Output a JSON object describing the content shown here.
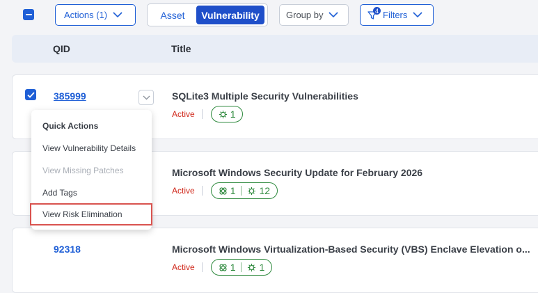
{
  "toolbar": {
    "actions_label": "Actions (1)",
    "view_toggle": {
      "asset": "Asset",
      "vulnerability": "Vulnerability"
    },
    "group_by_label": "Group by",
    "filters_label": "Filters",
    "filters_count": "4"
  },
  "table": {
    "columns": {
      "qid": "QID",
      "title": "Title"
    },
    "rows": [
      {
        "qid": "385999",
        "title": "SQLite3 Multiple Security Vulnerabilities",
        "status": "Active",
        "counts": {
          "a": "1"
        }
      },
      {
        "qid": "",
        "title": "Microsoft Windows Security Update for February 2026",
        "status": "Active",
        "counts": {
          "a": "1",
          "b": "12"
        }
      },
      {
        "qid": "92318",
        "title": "Microsoft Windows Virtualization-Based Security (VBS) Enclave Elevation o...",
        "status": "Active",
        "counts": {
          "a": "1",
          "b": "1"
        }
      }
    ]
  },
  "quick_actions": {
    "title": "Quick Actions",
    "items": [
      "View Vulnerability Details",
      "View Missing Patches",
      "Add Tags",
      "View Risk Elimination"
    ]
  },
  "colors": {
    "accent": "#1f5fd6",
    "status_active": "#d0281b",
    "pill_green": "#2f8a3e",
    "highlight_border": "#d9534f"
  },
  "icons": {
    "select_all": "minus-checkbox-icon",
    "row_checked": "check-icon",
    "dropdown": "chevron-down-icon",
    "filter": "filter-icon",
    "patch": "bandage-icon",
    "threat": "virus-icon"
  }
}
